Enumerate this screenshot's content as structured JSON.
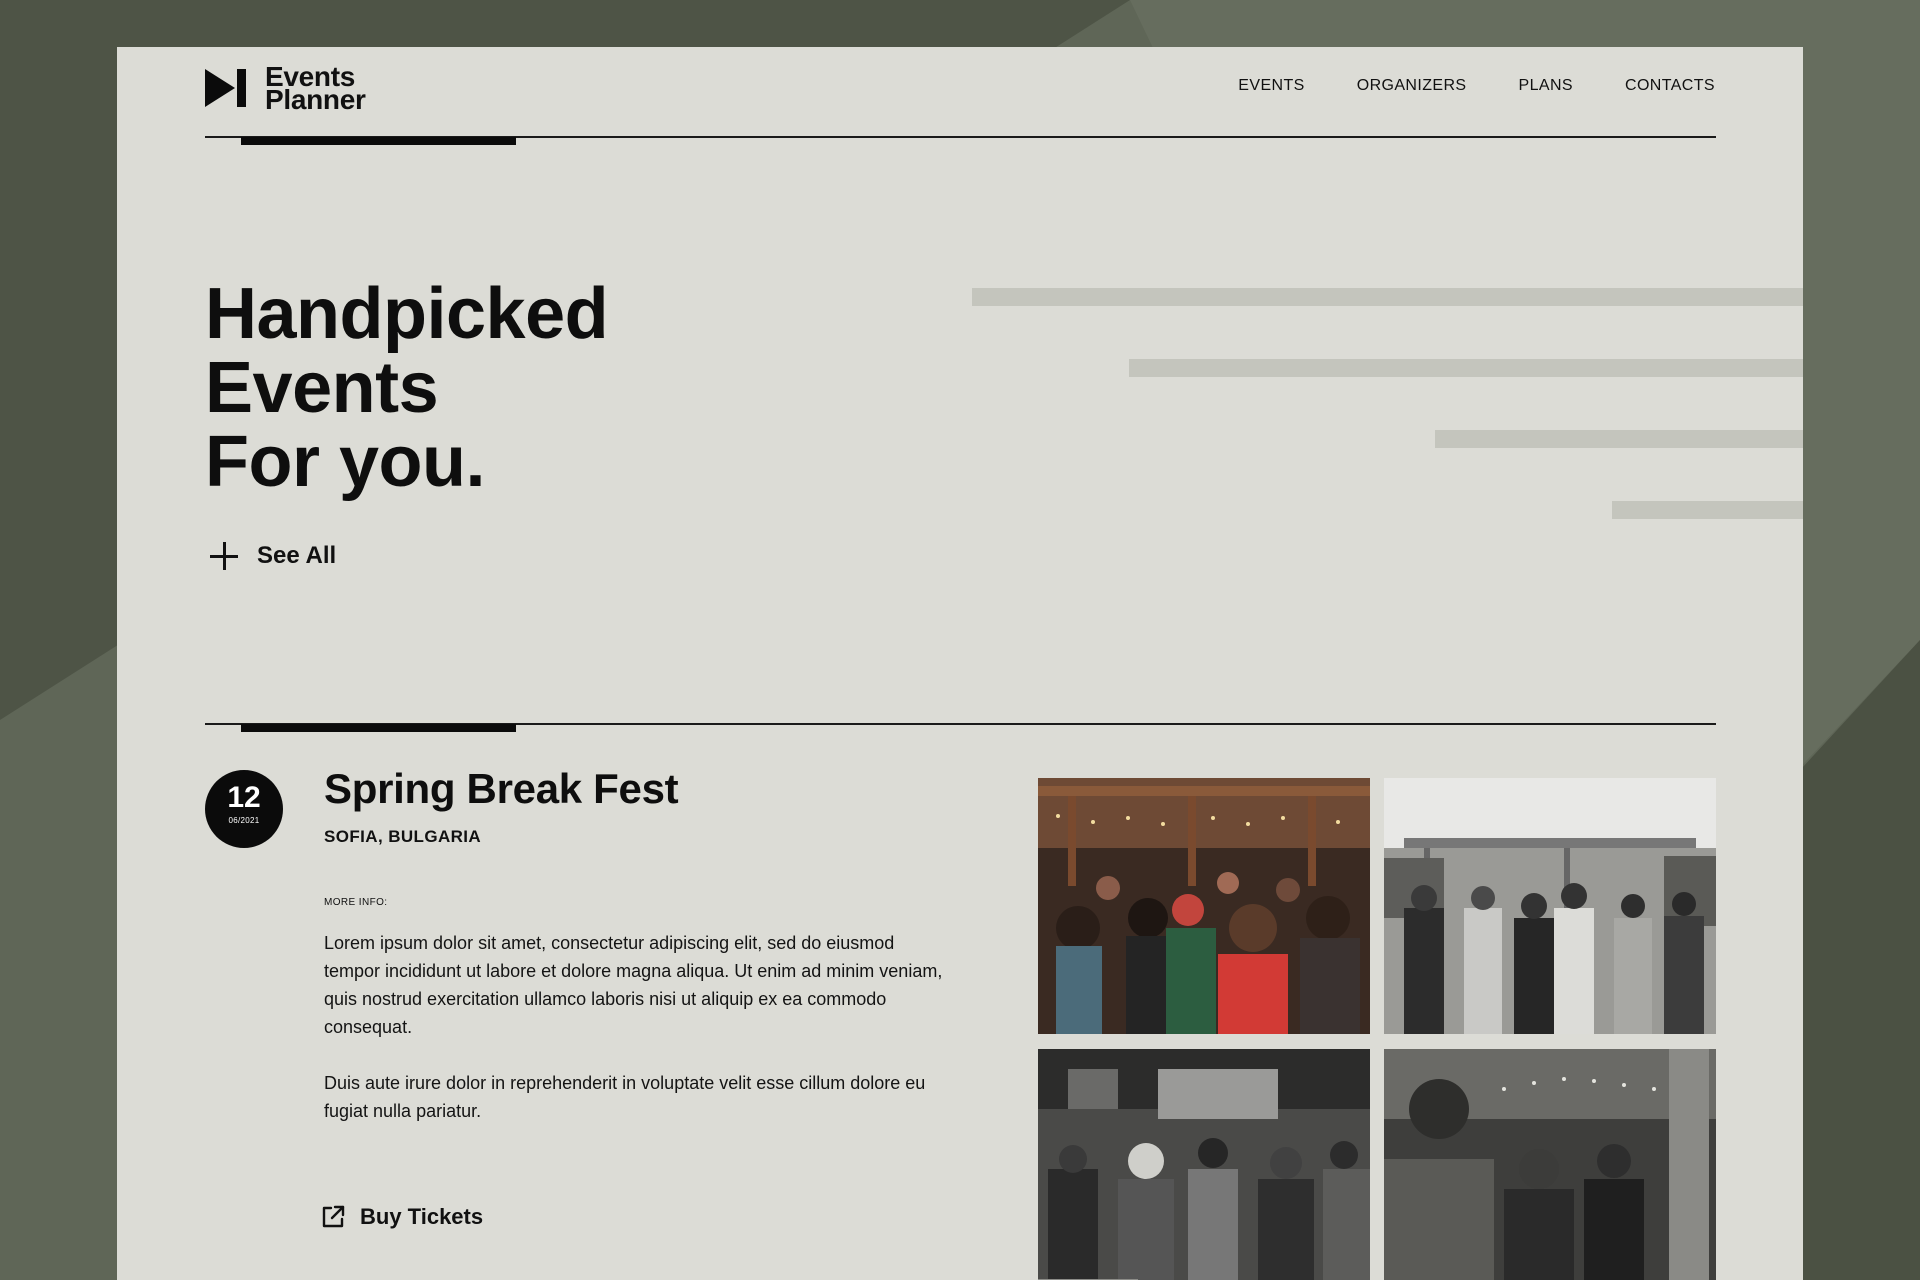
{
  "header": {
    "logo": {
      "line1": "Events",
      "line2": "Planner"
    },
    "nav": [
      "EVENTS",
      "ORGANIZERS",
      "PLANS",
      "CONTACTS"
    ]
  },
  "hero": {
    "title_lines": [
      "Handpicked",
      "Events",
      "For you."
    ],
    "see_all": "See All"
  },
  "event": {
    "day": "12",
    "month_year": "06/2021",
    "title": "Spring Break Fest",
    "location": "SOFIA, BULGARIA",
    "more_info_label": "MORE INFO:",
    "paragraphs": [
      "Lorem ipsum dolor sit amet, consectetur adipiscing elit, sed do eiusmod tempor incididunt ut labore et dolore magna aliqua. Ut enim ad minim veniam, quis nostrud exercitation ullamco laboris nisi ut aliquip ex ea commodo consequat.",
      "Duis aute irure dolor in reprehenderit in voluptate velit esse cillum dolore eu fugiat nulla pariatur."
    ],
    "buy_label": "Buy Tickets"
  },
  "colors": {
    "page_background": "#dcdcd6",
    "backdrop": "#5f6657",
    "accent": "#0b0b0b",
    "stripe": "#c4c5bd"
  },
  "icons": [
    "play-pause-logo-icon",
    "plus-icon",
    "external-link-icon"
  ]
}
